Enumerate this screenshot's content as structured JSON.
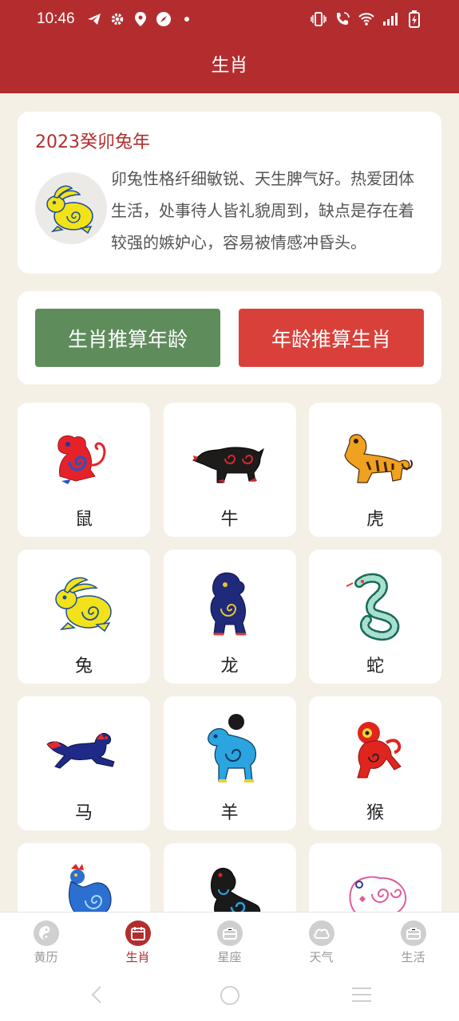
{
  "status_bar": {
    "time": "10:46",
    "left_icons": [
      "telegram-icon",
      "gear-icon",
      "location-icon",
      "compass-icon",
      "dot-icon"
    ],
    "right_icons": [
      "vibrate-icon",
      "wifi-call-icon",
      "wifi-icon",
      "signal-icon",
      "battery-charging-icon"
    ]
  },
  "header": {
    "title": "生肖"
  },
  "year_card": {
    "title": "2023癸卯兔年",
    "description": "卯兔性格纤细敏锐、天生脾气好。热爱团体生活，处事待人皆礼貌周到，缺点是存在着较强的嫉妒心，容易被情感冲昏头。",
    "avatar_icon": "rabbit-papercut-icon"
  },
  "actions": {
    "zodiac_to_age": "生肖推算年龄",
    "age_to_zodiac": "年龄推算生肖"
  },
  "zodiacs": [
    {
      "label": "鼠",
      "icon": "rat-icon"
    },
    {
      "label": "牛",
      "icon": "ox-icon"
    },
    {
      "label": "虎",
      "icon": "tiger-icon"
    },
    {
      "label": "兔",
      "icon": "rabbit-icon"
    },
    {
      "label": "龙",
      "icon": "dragon-icon"
    },
    {
      "label": "蛇",
      "icon": "snake-icon"
    },
    {
      "label": "马",
      "icon": "horse-icon"
    },
    {
      "label": "羊",
      "icon": "goat-icon"
    },
    {
      "label": "猴",
      "icon": "monkey-icon"
    },
    {
      "label": "",
      "icon": "rooster-icon"
    },
    {
      "label": "",
      "icon": "dog-icon"
    },
    {
      "label": "",
      "icon": "pig-icon"
    }
  ],
  "bottom_nav": [
    {
      "label": "黄历",
      "icon": "yin-yang-icon",
      "active": false
    },
    {
      "label": "生肖",
      "icon": "calendar-icon",
      "active": true
    },
    {
      "label": "星座",
      "icon": "briefcase-icon",
      "active": false
    },
    {
      "label": "天气",
      "icon": "cloud-icon",
      "active": false
    },
    {
      "label": "生活",
      "icon": "briefcase-icon",
      "active": false
    }
  ],
  "colors": {
    "brand_red": "#b32d2f",
    "green_button": "#5e8c5b",
    "red_button": "#d9403a",
    "background": "#f5f0e6"
  }
}
